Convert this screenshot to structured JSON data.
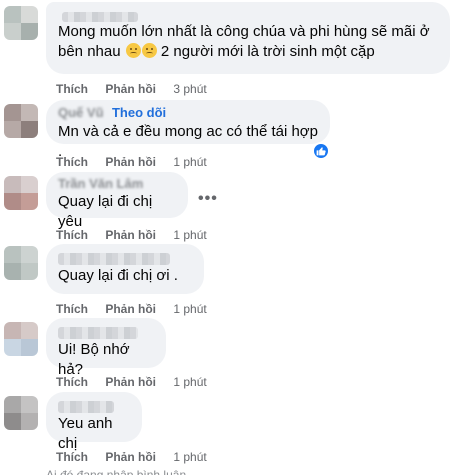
{
  "comments": [
    {
      "text_1": "Mong muốn lớn nhất là công chúa và phi hùng sẽ mãi ở",
      "text_2_start": "bên nhau",
      "text_2_end": "2 người mới là trời sinh một cặp",
      "emojis": [
        "sad-face-icon",
        "sad-face-icon"
      ],
      "actions": {
        "like": "Thích",
        "reply": "Phản hồi",
        "time": "3 phút"
      }
    },
    {
      "author": "Quế Vũ",
      "follow": "Theo dõi",
      "text": "Mn và cả e đều mong ac có thể tái hợp .",
      "reaction": "like-icon",
      "actions": {
        "like": "Thích",
        "reply": "Phản hồi",
        "time": "1 phút"
      }
    },
    {
      "author": "Trần Văn Lâm",
      "text": "Quay lại đi chị yêu",
      "more": "•••",
      "actions": {
        "like": "Thích",
        "reply": "Phản hồi",
        "time": "1 phút"
      }
    },
    {
      "text": "Quay lại đi chị ơi .",
      "actions": {
        "like": "Thích",
        "reply": "Phản hồi",
        "time": "1 phút"
      }
    },
    {
      "text": "Ui! Bộ nhớ hả?",
      "actions": {
        "like": "Thích",
        "reply": "Phản hồi",
        "time": "1 phút"
      }
    },
    {
      "text": "Yeu anh chị",
      "actions": {
        "like": "Thích",
        "reply": "Phản hồi",
        "time": "1 phút"
      }
    }
  ],
  "footer": "Ai đó đang nhập bình luận...",
  "colors": {
    "bubble": "#f0f2f5",
    "accent": "#216fdb",
    "meta": "#65676b",
    "like": "#1877f2"
  }
}
